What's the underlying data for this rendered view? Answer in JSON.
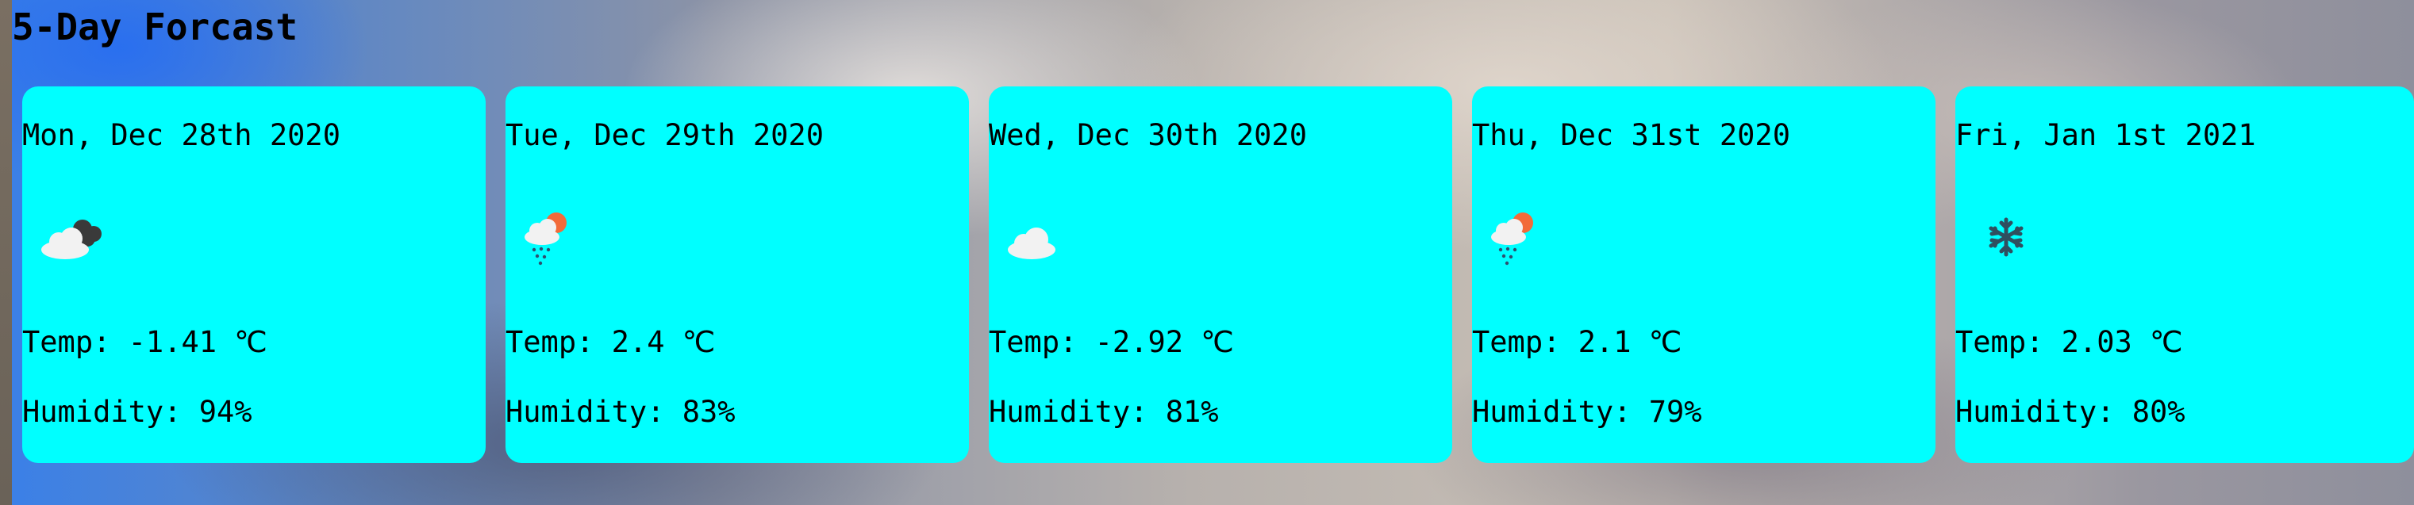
{
  "title": "5-Day Forcast",
  "forecast": [
    {
      "date": "Mon, Dec 28th 2020",
      "icon": "cloudy-night-icon",
      "temp": "Temp: -1.41 ℃",
      "humidity": "Humidity: 94%"
    },
    {
      "date": "Tue, Dec 29th 2020",
      "icon": "rain-sun-icon",
      "temp": "Temp: 2.4 ℃",
      "humidity": "Humidity: 83%"
    },
    {
      "date": "Wed, Dec 30th 2020",
      "icon": "cloud-icon",
      "temp": "Temp: -2.92 ℃",
      "humidity": "Humidity: 81%"
    },
    {
      "date": "Thu, Dec 31st 2020",
      "icon": "rain-sun-icon",
      "temp": "Temp: 2.1 ℃",
      "humidity": "Humidity: 79%"
    },
    {
      "date": "Fri, Jan 1st 2021",
      "icon": "snowflake-icon",
      "temp": "Temp: 2.03 ℃",
      "humidity": "Humidity: 80%"
    }
  ],
  "colors": {
    "card_background": "#00ffff",
    "text": "#000000"
  }
}
